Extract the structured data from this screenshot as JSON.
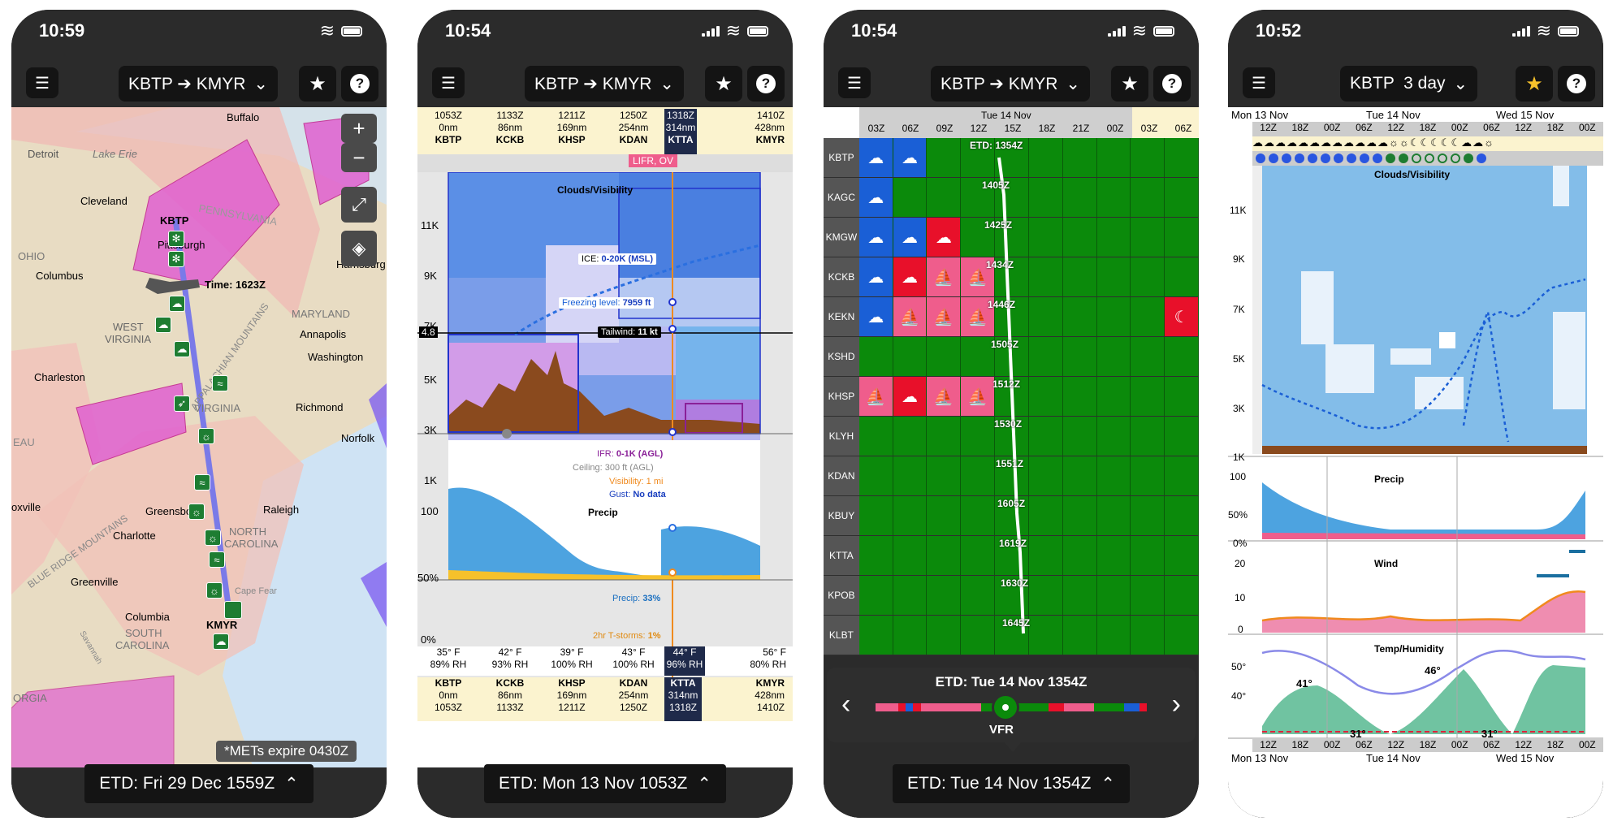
{
  "status_times": [
    "10:59",
    "10:54",
    "10:54",
    "10:52"
  ],
  "menu_icon": "hamburger-icon",
  "routes": [
    "KBTP ➔ KMYR",
    "KBTP ➔ KMYR",
    "KBTP ➔ KMYR",
    "KBTP  3 day"
  ],
  "etd_labels": [
    "ETD: Fri 29 Dec 1559Z",
    "ETD: Mon 13 Nov 1053Z",
    "ETD: Tue 14 Nov 1354Z"
  ],
  "map": {
    "places": [
      {
        "name": "Buffalo"
      },
      {
        "name": "Detroit"
      },
      {
        "name": "Lake Erie"
      },
      {
        "name": "Cleveland"
      },
      {
        "name": "OHIO"
      },
      {
        "name": "PENNSYLVANIA"
      },
      {
        "name": "Pittsburgh"
      },
      {
        "name": "Columbus"
      },
      {
        "name": "Harrisburg"
      },
      {
        "name": "WEST"
      },
      {
        "name": "VIRGINIA"
      },
      {
        "name": "MARYLAND"
      },
      {
        "name": "Annapolis"
      },
      {
        "name": "Washington"
      },
      {
        "name": "Charleston"
      },
      {
        "name": "VIRGINIA"
      },
      {
        "name": "Richmond"
      },
      {
        "name": "Norfolk"
      },
      {
        "name": "Greensboro"
      },
      {
        "name": "Raleigh"
      },
      {
        "name": "Charlotte"
      },
      {
        "name": "NORTH"
      },
      {
        "name": "CAROLINA"
      },
      {
        "name": "Greenville"
      },
      {
        "name": "Columbia"
      },
      {
        "name": "SOUTH"
      },
      {
        "name": "CAROLINA"
      },
      {
        "name": "ORGIA"
      },
      {
        "name": "BLUE RIDGE MOUNTAINS"
      },
      {
        "name": "APPALACHIAN MOUNTAINS"
      },
      {
        "name": "Cape Fear"
      },
      {
        "name": "Savannah"
      },
      {
        "name": "EAU"
      },
      {
        "name": "oxville"
      }
    ],
    "airports": [
      "KBTP",
      "KMYR"
    ],
    "time_label": "Time: 1623Z",
    "met_note": "*METs expire 0430Z",
    "zoom_in": "+",
    "zoom_out": "−"
  },
  "profile": {
    "waypoints": [
      {
        "time": "1053Z",
        "dist": "0nm",
        "id": "KBTP"
      },
      {
        "time": "1133Z",
        "dist": "86nm",
        "id": "KCKB"
      },
      {
        "time": "1211Z",
        "dist": "169nm",
        "id": "KHSP"
      },
      {
        "time": "1250Z",
        "dist": "254nm",
        "id": "KDAN"
      },
      {
        "time": "1318Z",
        "dist": "314nm",
        "id": "KTTA"
      },
      {
        "time": "1410Z",
        "dist": "428nm",
        "id": "KMYR"
      }
    ],
    "flag": "LIFR, OV",
    "cloud_title": "Clouds/Visibility",
    "alt_ticks": [
      "11K",
      "9K",
      "7K",
      "5K",
      "3K",
      "1K"
    ],
    "alt_marker": "4.8",
    "ice": {
      "label": "ICE:",
      "value": "0-20K (MSL)"
    },
    "freezing": {
      "label": "Freezing level:",
      "value": "7959 ft"
    },
    "tailwind": {
      "label": "Tailwind:",
      "value": "11 kt"
    },
    "ifr": {
      "label": "IFR:",
      "value": "0-1K (AGL)"
    },
    "ceiling": {
      "label": "Ceiling:",
      "value": "300 ft (AGL)"
    },
    "visibility": {
      "label": "Visibility:",
      "value": "1 mi"
    },
    "gust": {
      "label": "Gust:",
      "value": "No data"
    },
    "precip_title": "Precip",
    "precip_ticks": [
      "100",
      "50%",
      "0%"
    ],
    "precip": {
      "label": "Precip:",
      "value": "33%"
    },
    "tstorms": {
      "label": "2hr T-storms:",
      "value": "1%"
    },
    "temps": [
      {
        "t": "35° F",
        "rh": "89% RH"
      },
      {
        "t": "42° F",
        "rh": "93% RH"
      },
      {
        "t": "39° F",
        "rh": "100% RH"
      },
      {
        "t": "43° F",
        "rh": "100% RH"
      },
      {
        "t": "44° F",
        "rh": "96% RH"
      },
      {
        "t": "56° F",
        "rh": "80% RH"
      }
    ]
  },
  "grid": {
    "day_header": "Tue 14 Nov",
    "hours": [
      "03Z",
      "06Z",
      "09Z",
      "12Z",
      "15Z",
      "18Z",
      "21Z",
      "00Z",
      "03Z",
      "06Z"
    ],
    "rows": [
      {
        "id": "KBTP",
        "time": "ETD: 1354Z",
        "cells": [
          "blue",
          "blue",
          "green",
          "green",
          "green",
          "green",
          "green",
          "green",
          "green",
          "green"
        ]
      },
      {
        "id": "KAGC",
        "time": "1405Z",
        "cells": [
          "blue",
          "green",
          "green",
          "green",
          "green",
          "green",
          "green",
          "green",
          "green",
          "green"
        ]
      },
      {
        "id": "KMGW",
        "time": "1425Z",
        "cells": [
          "blue",
          "blue",
          "red",
          "green",
          "green",
          "green",
          "green",
          "green",
          "green",
          "green"
        ]
      },
      {
        "id": "KCKB",
        "time": "1434Z",
        "cells": [
          "blue",
          "red",
          "pink",
          "pink",
          "green",
          "green",
          "green",
          "green",
          "green",
          "green"
        ]
      },
      {
        "id": "KEKN",
        "time": "1446Z",
        "cells": [
          "blue",
          "pink",
          "pink",
          "pink",
          "green",
          "green",
          "green",
          "green",
          "green",
          "red"
        ]
      },
      {
        "id": "KSHD",
        "time": "1505Z",
        "cells": [
          "green",
          "green",
          "green",
          "green",
          "green",
          "green",
          "green",
          "green",
          "green",
          "green"
        ]
      },
      {
        "id": "KHSP",
        "time": "1512Z",
        "cells": [
          "pink",
          "red",
          "pink",
          "pink",
          "green",
          "green",
          "green",
          "green",
          "green",
          "green"
        ]
      },
      {
        "id": "KLYH",
        "time": "1530Z",
        "cells": [
          "green",
          "green",
          "green",
          "green",
          "green",
          "green",
          "green",
          "green",
          "green",
          "green"
        ]
      },
      {
        "id": "KDAN",
        "time": "1551Z",
        "cells": [
          "green",
          "green",
          "green",
          "green",
          "green",
          "green",
          "green",
          "green",
          "green",
          "green"
        ]
      },
      {
        "id": "KBUY",
        "time": "1605Z",
        "cells": [
          "green",
          "green",
          "green",
          "green",
          "green",
          "green",
          "green",
          "green",
          "green",
          "green"
        ]
      },
      {
        "id": "KTTA",
        "time": "1619Z",
        "cells": [
          "green",
          "green",
          "green",
          "green",
          "green",
          "green",
          "green",
          "green",
          "green",
          "green"
        ]
      },
      {
        "id": "KPOB",
        "time": "1630Z",
        "cells": [
          "green",
          "green",
          "green",
          "green",
          "green",
          "green",
          "green",
          "green",
          "green",
          "green"
        ]
      },
      {
        "id": "KLBT",
        "time": "1645Z",
        "cells": [
          "green",
          "green",
          "green",
          "green",
          "green",
          "green",
          "green",
          "green",
          "green",
          "green"
        ]
      }
    ],
    "popup_title": "ETD: Tue 14 Nov 1354Z",
    "popup_cat": "VFR",
    "prev": "‹",
    "next": "›"
  },
  "threeday": {
    "days": [
      "Mon 13 Nov",
      "Tue 14 Nov",
      "Wed 15 Nov"
    ],
    "hours": [
      "12Z",
      "18Z",
      "00Z",
      "06Z",
      "12Z",
      "18Z",
      "00Z",
      "06Z",
      "12Z",
      "18Z",
      "00Z"
    ],
    "cloud_title": "Clouds/Visibility",
    "alt_ticks": [
      "11K",
      "9K",
      "7K",
      "5K",
      "3K",
      "1K"
    ],
    "precip_title": "Precip",
    "precip_ticks": [
      "100",
      "50%",
      "0%"
    ],
    "wind_title": "Wind",
    "wind_ticks": [
      "20",
      "10",
      "0"
    ],
    "temp_title": "Temp/Humidity",
    "temp_ticks": [
      "50°",
      "40°"
    ],
    "temp_labels": [
      "41°",
      "46°",
      "31°",
      "31°"
    ]
  }
}
